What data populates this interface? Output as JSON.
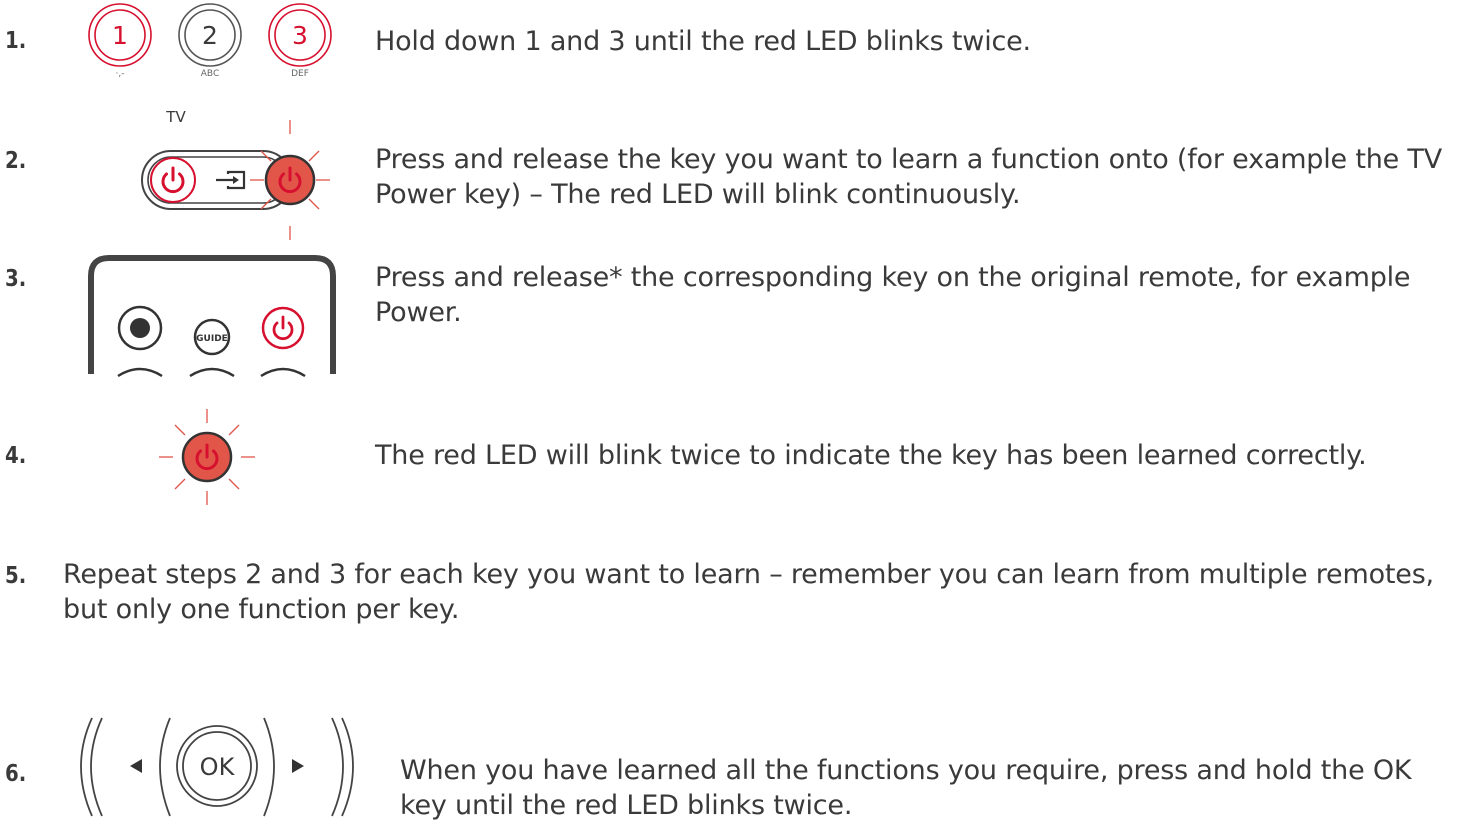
{
  "colors": {
    "accent": "#d6102e",
    "led": "#e2564a",
    "text": "#3a3a3a",
    "outline": "#444444"
  },
  "steps": [
    {
      "number": "1.",
      "text": "Hold down 1 and 3 until the red LED blinks twice."
    },
    {
      "number": "2.",
      "text": "Press and release the key you want to learn a function onto (for example the TV Power key) – The red LED will blink continuously."
    },
    {
      "number": "3.",
      "text": "Press and release* the corresponding key on the original remote, for example Power."
    },
    {
      "number": "4.",
      "text": "The red LED will blink twice to indicate the key has been learned correctly."
    },
    {
      "number": "5.",
      "text": "Repeat steps 2 and 3 for each key you want to learn – remember you can learn from multiple remotes, but only one function per key."
    },
    {
      "number": "6.",
      "text": "When you have learned all the functions you require, press and hold the OK key until the red LED blinks twice."
    }
  ],
  "keys": {
    "key1": {
      "digit": "1",
      "sub": "·,-"
    },
    "key2": {
      "digit": "2",
      "sub": "ABC"
    },
    "key3": {
      "digit": "3",
      "sub": "DEF"
    },
    "tv_label": "TV",
    "guide_label": "GUIDE",
    "ok_label": "OK"
  },
  "icons": [
    "power-icon",
    "input-source-icon",
    "record-icon",
    "led-indicator-icon",
    "arrow-left-icon",
    "arrow-right-icon"
  ]
}
